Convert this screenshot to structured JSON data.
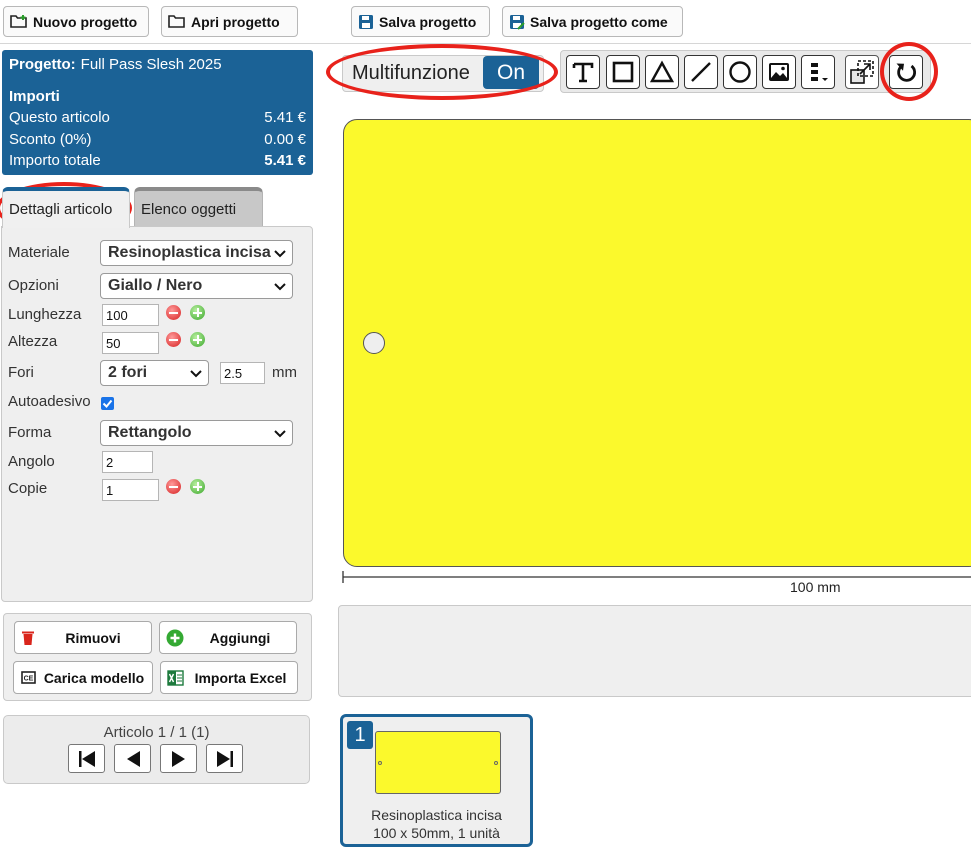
{
  "toolbar": {
    "new_project": "Nuovo progetto",
    "open_project": "Apri progetto",
    "save_project": "Salva progetto",
    "save_project_as": "Salva progetto come"
  },
  "project": {
    "label": "Progetto:",
    "name": "Full Pass Slesh 2025",
    "amounts_title": "Importi",
    "rows": [
      {
        "label": "Questo articolo",
        "value": "5.41 €"
      },
      {
        "label": "Sconto (0%)",
        "value": "0.00 €"
      },
      {
        "label": "Importo totale",
        "value": "5.41 €"
      }
    ]
  },
  "tabs": {
    "details": "Dettagli articolo",
    "objects": "Elenco oggetti"
  },
  "form": {
    "material_label": "Materiale",
    "material_value": "Resinoplastica incisa",
    "options_label": "Opzioni",
    "options_value": "Giallo / Nero",
    "length_label": "Lunghezza",
    "length_value": "100",
    "height_label": "Altezza",
    "height_value": "50",
    "holes_label": "Fori",
    "holes_value": "2 fori",
    "hole_size_value": "2.5",
    "hole_unit": "mm",
    "adhesive_label": "Autoadesivo",
    "adhesive_checked": true,
    "shape_label": "Forma",
    "shape_value": "Rettangolo",
    "corner_label": "Angolo",
    "corner_value": "2",
    "copies_label": "Copie",
    "copies_value": "1"
  },
  "actions": {
    "remove": "Rimuovi",
    "add": "Aggiungi",
    "load_template": "Carica modello",
    "import_excel": "Importa Excel"
  },
  "navigation": {
    "article_counter": "Articolo 1 / 1 (1)"
  },
  "editor": {
    "multifunction_label": "Multifunzione",
    "multifunction_state": "On",
    "ruler_label": "100 mm",
    "tools": [
      "text-tool-icon",
      "rectangle-tool-icon",
      "triangle-tool-icon",
      "line-tool-icon",
      "circle-tool-icon",
      "image-tool-icon",
      "align-menu-icon",
      "resize-icon",
      "rotate-icon"
    ],
    "label_color": "#fbf92c"
  },
  "thumbnail": {
    "index": "1",
    "material": "Resinoplastica incisa",
    "summary": "100 x 50mm, 1 unità"
  },
  "colors": {
    "accent": "#1b6296",
    "highlight_ring": "#e8221b"
  }
}
